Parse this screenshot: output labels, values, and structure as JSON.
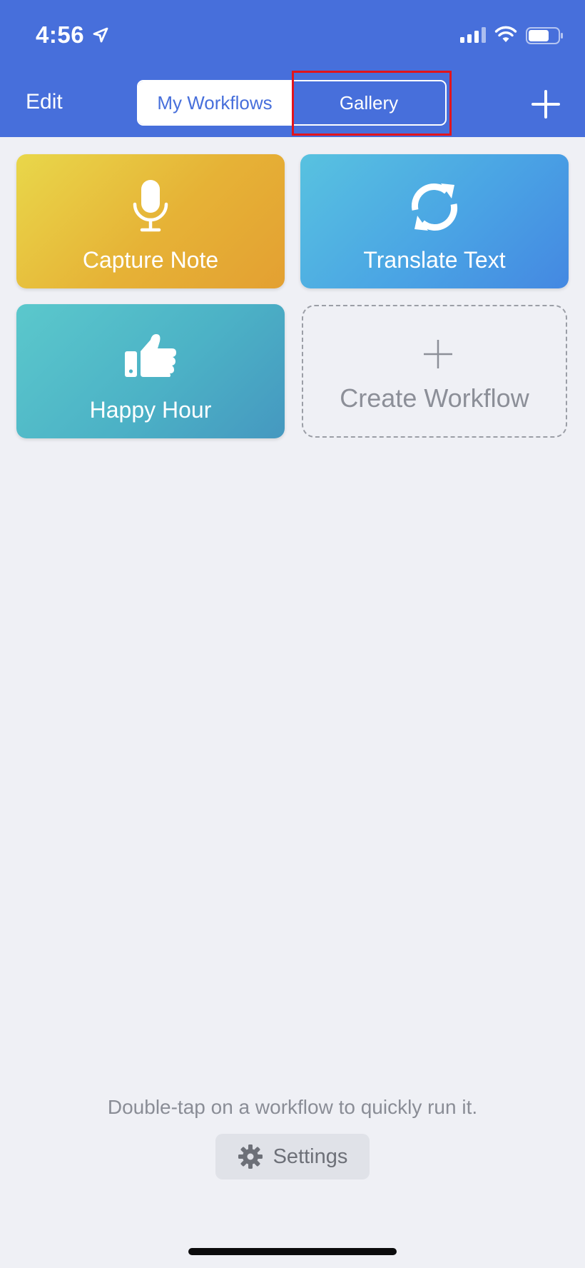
{
  "status_bar": {
    "time": "4:56"
  },
  "nav": {
    "edit_label": "Edit",
    "tabs": [
      {
        "label": "My Workflows",
        "selected": true
      },
      {
        "label": "Gallery",
        "selected": false
      }
    ],
    "add_icon": "plus-icon"
  },
  "workflows": [
    {
      "label": "Capture Note",
      "icon": "microphone-icon"
    },
    {
      "label": "Translate Text",
      "icon": "refresh-icon"
    },
    {
      "label": "Happy Hour",
      "icon": "thumbs-up-icon"
    }
  ],
  "create_workflow": {
    "label": "Create Workflow",
    "icon": "plus-icon"
  },
  "footer": {
    "hint": "Double-tap on a workflow to quickly run it.",
    "settings_label": "Settings",
    "settings_icon": "gear-icon"
  },
  "colors": {
    "header": "#476fdb",
    "background": "#eff0f5",
    "highlight": "#e2141c"
  }
}
